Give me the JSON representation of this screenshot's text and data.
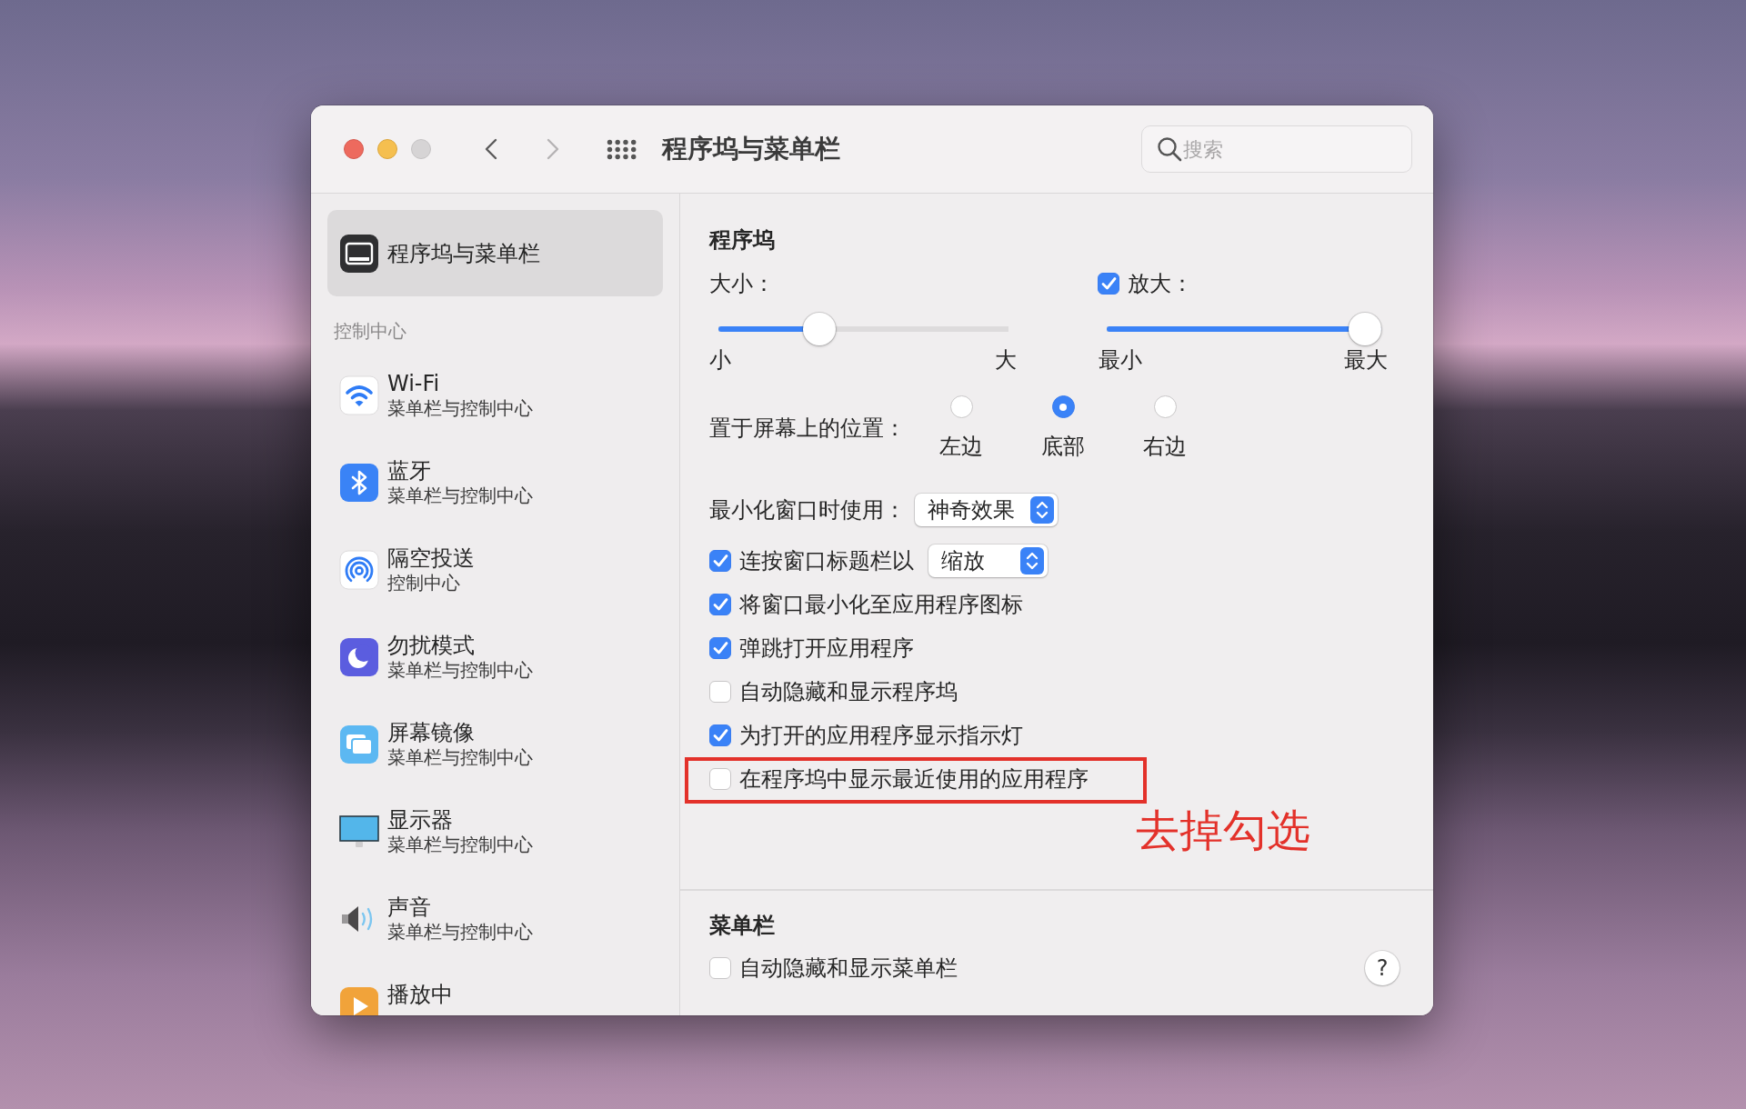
{
  "window": {
    "title": "程序坞与菜单栏",
    "controls": [
      {
        "kind": "close",
        "disabled": false
      },
      {
        "kind": "minimize",
        "disabled": false
      },
      {
        "kind": "zoom",
        "disabled": true
      }
    ],
    "navigation": [
      {
        "kind": "back",
        "disabled": false
      },
      {
        "kind": "forward",
        "disabled": true
      }
    ],
    "search": {
      "placeholder": "搜索"
    }
  },
  "sidebar": {
    "items": [
      {
        "kind": "dock",
        "title": "程序坞与菜单栏",
        "selected": true
      }
    ],
    "section_title": "控制中心",
    "section_items": [
      {
        "kind": "wifi",
        "title": "Wi-Fi",
        "subtitle": "菜单栏与控制中心",
        "selected": false
      },
      {
        "kind": "bluetooth",
        "title": "蓝牙",
        "subtitle": "菜单栏与控制中心",
        "selected": false
      },
      {
        "kind": "airdrop",
        "title": "隔空投送",
        "subtitle": "控制中心",
        "selected": false
      },
      {
        "kind": "focus",
        "title": "勿扰模式",
        "subtitle": "菜单栏与控制中心",
        "selected": false
      },
      {
        "kind": "mirroring",
        "title": "屏幕镜像",
        "subtitle": "菜单栏与控制中心",
        "selected": false
      },
      {
        "kind": "display",
        "title": "显示器",
        "subtitle": "菜单栏与控制中心",
        "selected": false
      },
      {
        "kind": "sound",
        "title": "声音",
        "subtitle": "菜单栏与控制中心",
        "selected": false
      },
      {
        "kind": "now_playing",
        "title": "播放中",
        "selected": false
      }
    ]
  },
  "dock": {
    "heading": "程序坞",
    "size": {
      "label": "大小：",
      "level": 0.33,
      "min_label": "小",
      "max_label": "大"
    },
    "magnification": {
      "label": "放大：",
      "checked": true,
      "level": 1,
      "min_label": "最小",
      "max_label": "最大"
    },
    "position": {
      "label": "置于屏幕上的位置：",
      "options": [
        {
          "label": "左边",
          "selected": false
        },
        {
          "label": "底部",
          "selected": true
        },
        {
          "label": "右边",
          "selected": false
        }
      ]
    },
    "options": [
      {
        "kind": "popup",
        "label": "最小化窗口时使用：",
        "value": "神奇效果",
        "highlighted": false
      },
      {
        "kind": "checkbox_popup",
        "label": "连按窗口标题栏以",
        "checked": true,
        "value": "缩放",
        "highlighted": false
      },
      {
        "kind": "checkbox",
        "label": "将窗口最小化至应用程序图标",
        "checked": true,
        "highlighted": false
      },
      {
        "kind": "checkbox",
        "label": "弹跳打开应用程序",
        "checked": true,
        "highlighted": false
      },
      {
        "kind": "checkbox",
        "label": "自动隐藏和显示程序坞",
        "checked": false,
        "highlighted": false
      },
      {
        "kind": "checkbox",
        "label": "为打开的应用程序显示指示灯",
        "checked": true,
        "highlighted": false
      },
      {
        "kind": "checkbox",
        "label": "在程序坞中显示最近使用的应用程序",
        "checked": false,
        "highlighted": true
      }
    ],
    "annotation": {
      "text": "去掉勾选"
    }
  },
  "menu_bar": {
    "heading": "菜单栏",
    "options": [
      {
        "kind": "checkbox",
        "label": "自动隐藏和显示菜单栏",
        "checked": false
      }
    ],
    "help_button": {
      "label": "?"
    }
  }
}
